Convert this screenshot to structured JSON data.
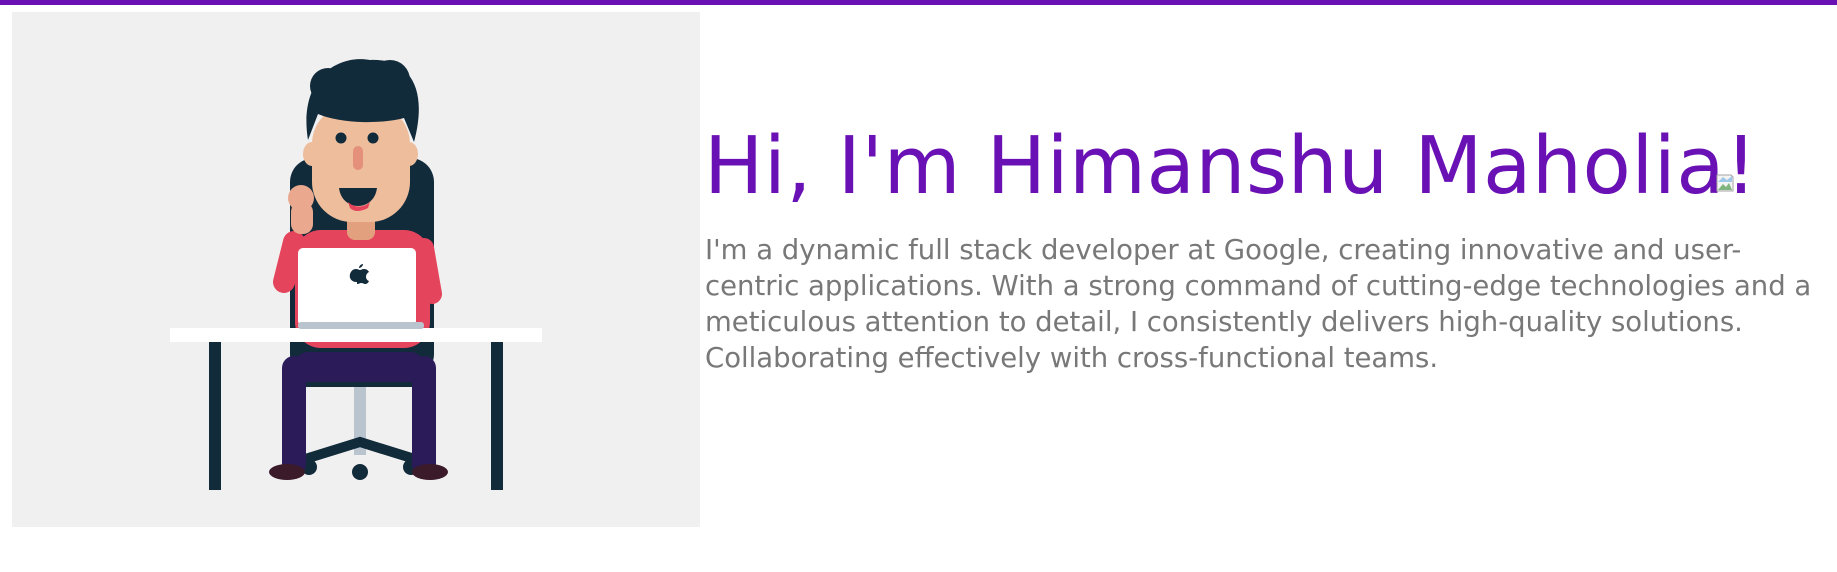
{
  "hero": {
    "greeting": "Hi, I'm Himanshu Maholia!",
    "bio": "I'm a dynamic full stack developer at Google, creating innovative and user-centric applications. With a strong command of cutting-edge technologies and a meticulous attention to detail, I consistently delivers high-quality solutions. Collaborating effectively with cross-functional teams.",
    "illustration": "developer-at-laptop-illustration",
    "wave_image": "broken-image-icon"
  },
  "colors": {
    "accent": "#6a11b5",
    "body_text": "#787878",
    "panel_bg": "#f0f0f1"
  }
}
